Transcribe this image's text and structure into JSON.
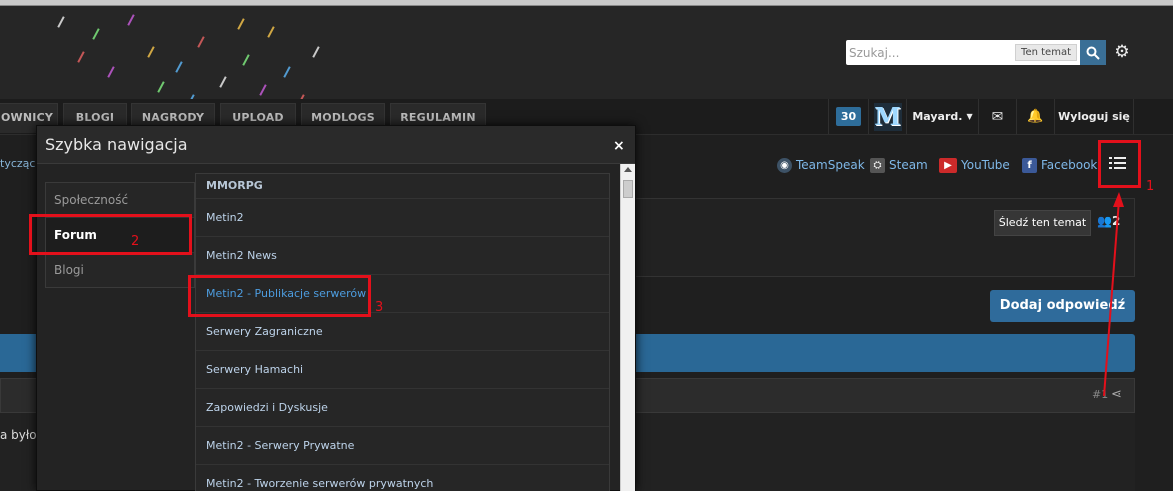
{
  "colors": {
    "accent": "#2f6b9b",
    "annotation": "#e3101b",
    "link": "#4d9de0"
  },
  "search": {
    "placeholder": "Szukaj...",
    "scope": "Ten temat"
  },
  "nav": {
    "tabs": [
      "OWNICY",
      "BLOGI",
      "NAGRODY",
      "UPLOAD",
      "MODLOGS",
      "REGULAMIN"
    ]
  },
  "userbar": {
    "badge_count": "30",
    "avatar_letter": "M",
    "username": "Mayard.",
    "logout": "Wyloguj się"
  },
  "social": {
    "items": [
      "TeamSpeak",
      "Steam",
      "YouTube",
      "Facebook"
    ]
  },
  "breadcrumb_fragment": "tyczące",
  "topic": {
    "follow": "Śledź ten temat",
    "followers": "2",
    "reply": "Dodaj odpowiedź",
    "post_number": "#1",
    "post_text": "a było"
  },
  "quick_nav": {
    "title": "Szybka nawigacja",
    "close": "×",
    "categories": [
      "Społeczność",
      "Forum",
      "Blogi"
    ],
    "active_category": "Forum",
    "forums": [
      "MMORPG",
      "Metin2",
      "Metin2 News",
      "Metin2 - Publikacje serwerów",
      "Serwery Zagraniczne",
      "Serwery Hamachi",
      "Zapowiedzi i Dyskusje",
      "Metin2 - Serwery Prywatne",
      "Metin2 - Tworzenie serwerów prywatnych"
    ]
  },
  "annotations": [
    "1",
    "2",
    "3"
  ]
}
